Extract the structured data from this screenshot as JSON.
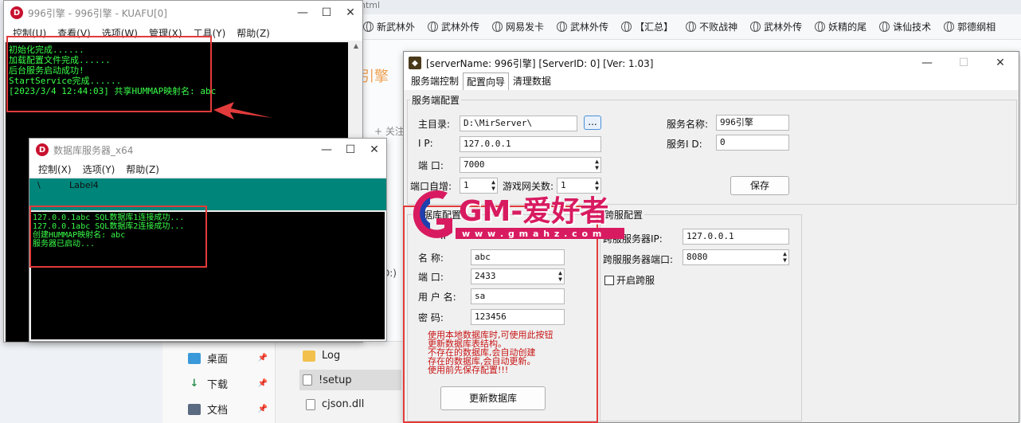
{
  "browser": {
    "tab_fragment": "html",
    "bookmarks": [
      "新武林外",
      "武林外传",
      "网易发卡",
      "武林外传",
      "【汇总】",
      "不败战神",
      "武林外传",
      "妖精的尾",
      "诛仙技术",
      "郭德纲相"
    ],
    "bg_orange_text": "引擎",
    "bg_follow_text": "+ 关注",
    "bg_misc_text": "D:)"
  },
  "explorer": {
    "left_items": [
      {
        "label": "桌面",
        "icon": "desktop-icon",
        "color": "#3a9ad9"
      },
      {
        "label": "下载",
        "icon": "download-icon",
        "color": "#2d8f4e"
      },
      {
        "label": "文档",
        "icon": "document-icon",
        "color": "#5a6a80"
      }
    ],
    "right_items": [
      {
        "label": "Log",
        "icon": "folder-icon"
      },
      {
        "label": "!setup",
        "icon": "file-icon"
      },
      {
        "label": "cjson.dll",
        "icon": "dll-file-icon"
      }
    ]
  },
  "main_window": {
    "title": "996引擎 - 996引擎 - KUAFU[0]",
    "menu": [
      "控制(U)",
      "查看(V)",
      "选项(W)",
      "管理(X)",
      "工具(Y)",
      "帮助(Z)"
    ],
    "log": [
      "初始化完成......",
      "加载配置文件完成......",
      "后台服务启动成功!",
      "StartService完成......",
      "[2023/3/4 12:44:03] 共享HUMMAP映射名: abc"
    ]
  },
  "db_window": {
    "title": "数据库服务器_x64",
    "menu": [
      "控制(X)",
      "选项(Y)",
      "帮助(Z)"
    ],
    "status_left": "\\",
    "status_label": "Label4",
    "log": [
      "127.0.0.1abc SQL数据库1连接成功...",
      "127.0.0.1abc SQL数据库2连接成功...",
      "创建HUMMAP映射名: abc",
      "服务器已启动..."
    ]
  },
  "config_window": {
    "title": "[serverName: 996引擎] [ServerID: 0] [Ver:  1.03]",
    "tabs": [
      "服务端控制",
      "配置向导",
      "清理数据"
    ],
    "active_tab": 1,
    "server_group_title": "服务端配置",
    "main_dir_label": "主目录:",
    "main_dir_value": "D:\\MirServer\\",
    "browse_label": "...",
    "ip_label": "I    P:",
    "ip_value": "127.0.0.1",
    "port_label": "端    口:",
    "port_value": "7000",
    "port_auto_label": "端口自增:",
    "port_auto_value": "1",
    "gateway_label": "游戏网关数:",
    "gateway_value": "1",
    "server_name_label": "服务名称:",
    "server_name_value": "996引擎",
    "server_id_label": "服务I  D:",
    "server_id_value": "0",
    "save_label": "保存",
    "db_group_title": "数据库配置",
    "db_ip_fragment": "IP",
    "db_name_label": "名    称:",
    "db_name_value": "abc",
    "db_port_label": "端    口:",
    "db_port_value": "2433",
    "db_user_label": "用 户 名:",
    "db_user_value": "sa",
    "db_pass_label": "密    码:",
    "db_pass_value": "123456",
    "db_note": "使用本地数据库时,可使用此按钮更新数据库表结构。\n不存在的数据库,会自动创建\n存在的数据库,会自动更新。\n使用前先保存配置!!!",
    "update_db_label": "更新数据库",
    "cross_group_title": "跨服配置",
    "cross_ip_label": "跨服服务器IP:",
    "cross_ip_value": "127.0.0.1",
    "cross_port_label": "跨服服务器端口:",
    "cross_port_value": "8080",
    "cross_enable_label": "开启跨服",
    "cross_enabled": false
  },
  "watermark": {
    "text": "GM-爱好者",
    "url": "w w w . g m a h z . c o m"
  },
  "colors": {
    "console_green": "#39ff4a",
    "teal_status": "#00857a",
    "highlight_red": "#e23b3b",
    "note_red": "#c81414",
    "logo_red": "#c8102e"
  }
}
